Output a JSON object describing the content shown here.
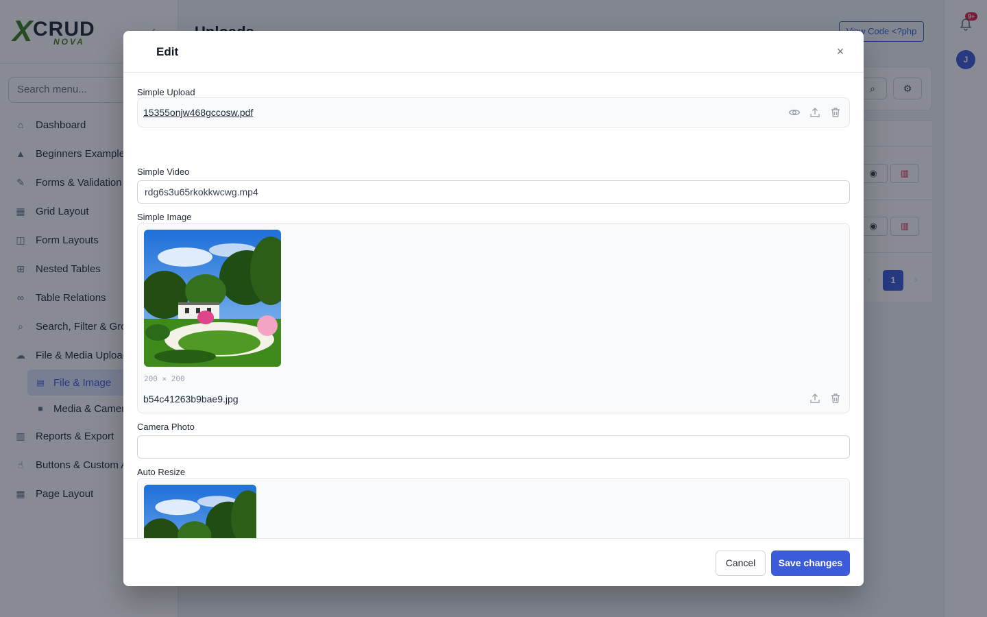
{
  "app": {
    "logo_x": "X",
    "logo_crud": "CRUD",
    "logo_nova": "NOVA",
    "page_title": "Uploads",
    "view_code_label": "View Code <?php",
    "notification_badge": "9+",
    "avatar_initial": "J",
    "active_page": "1"
  },
  "sidebar": {
    "search_placeholder": "Search menu...",
    "items": [
      {
        "label": "Dashboard",
        "icon": "home-icon"
      },
      {
        "label": "Beginners Examples",
        "icon": "graduation-cap-icon"
      },
      {
        "label": "Forms & Validation",
        "icon": "edit-icon"
      },
      {
        "label": "Grid Layout",
        "icon": "grid-icon"
      },
      {
        "label": "Form Layouts",
        "icon": "columns-icon"
      },
      {
        "label": "Nested Tables",
        "icon": "sitemap-icon"
      },
      {
        "label": "Table Relations",
        "icon": "link-icon"
      },
      {
        "label": "Search, Filter & Group",
        "icon": "search-icon"
      },
      {
        "label": "File & Media Uploads",
        "icon": "cloud-upload-icon"
      },
      {
        "label": "Reports & Export",
        "icon": "bar-chart-icon"
      },
      {
        "label": "Buttons & Custom Actions",
        "icon": "hand-pointer-icon"
      },
      {
        "label": "Page Layout",
        "icon": "layout-icon"
      }
    ],
    "sub_items": [
      {
        "label": "File & Image",
        "icon": "file-image-icon",
        "active": true
      },
      {
        "label": "Media & Camera",
        "icon": "video-icon",
        "active": false
      }
    ]
  },
  "modal": {
    "title": "Edit",
    "fields": {
      "simple_upload": {
        "label": "Simple Upload",
        "file": "15355onjw468gccosw.pdf"
      },
      "simple_video": {
        "label": "Simple Video",
        "value": "rdg6s3u65rkokkwcwg.mp4"
      },
      "simple_image": {
        "label": "Simple Image",
        "dims": "200 × 200",
        "file": "b54c41263b9bae9.jpg"
      },
      "camera_photo": {
        "label": "Camera Photo",
        "value": ""
      },
      "auto_resize": {
        "label": "Auto Resize"
      }
    },
    "cancel_label": "Cancel",
    "save_label": "Save changes"
  },
  "colors": {
    "accent": "#3b5bdb",
    "danger": "#e11d48",
    "overlay": "rgba(17,24,39,0.5)"
  }
}
